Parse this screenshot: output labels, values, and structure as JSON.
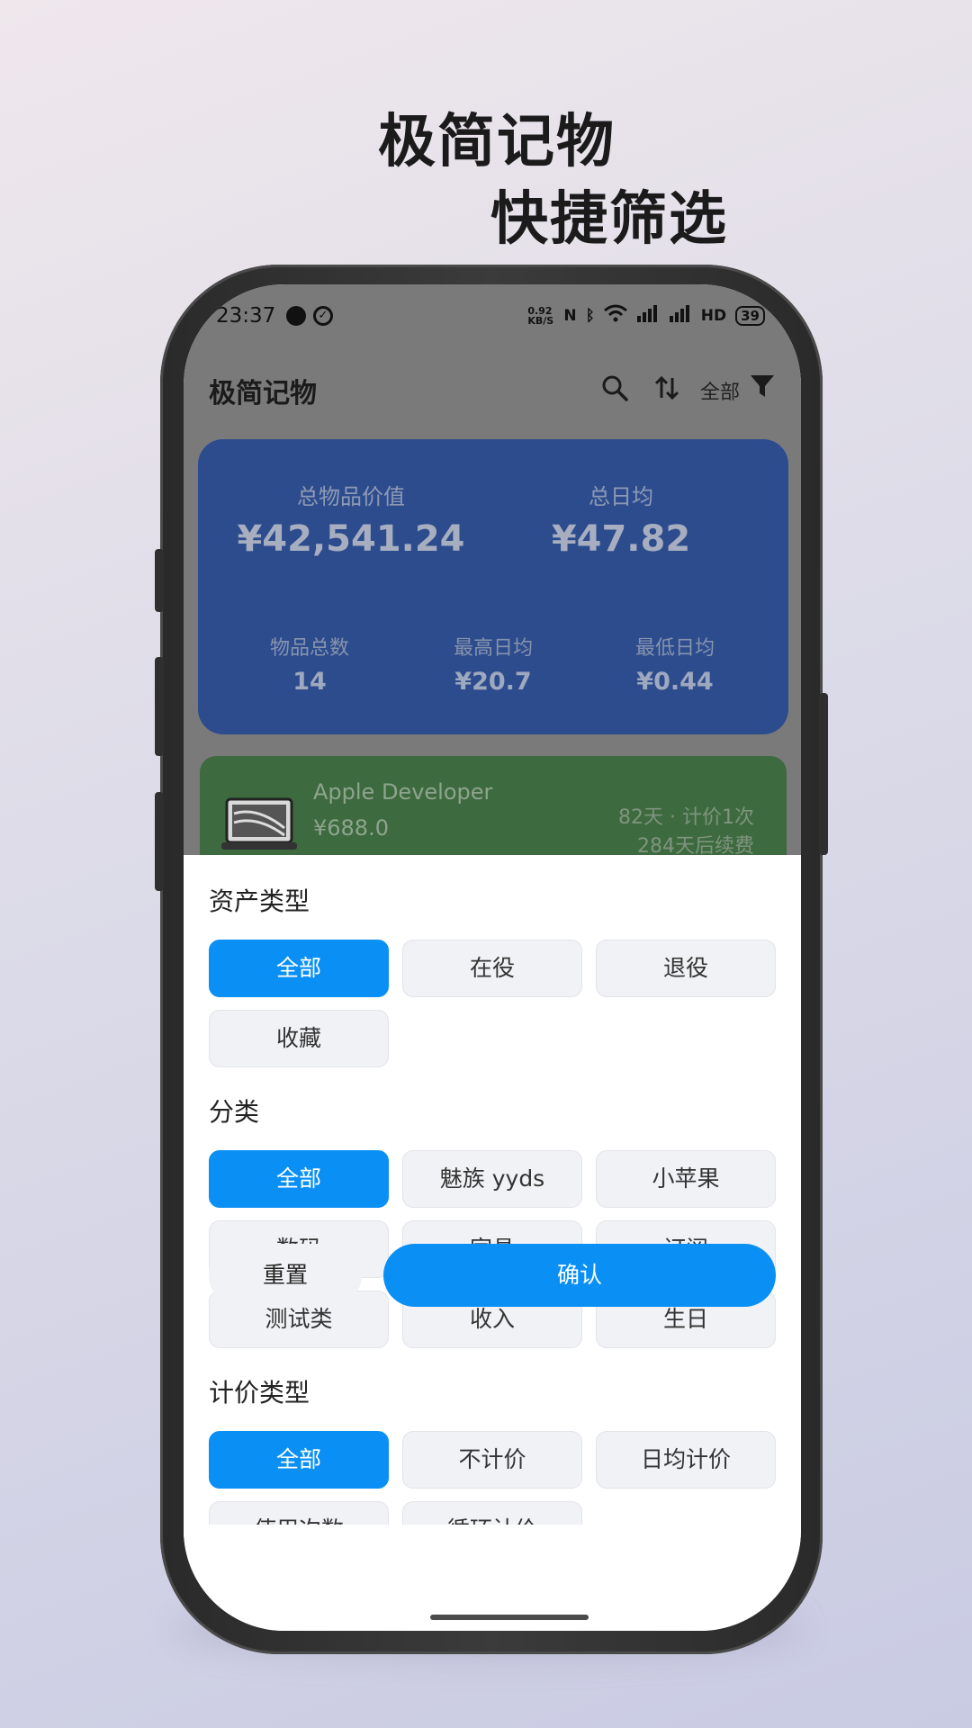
{
  "promo": {
    "title": "极简记物",
    "subtitle": "快捷筛选"
  },
  "status_bar": {
    "time": "23:37",
    "net_speed": "0.92 KB/S",
    "network": "HD",
    "battery": "39"
  },
  "app_bar": {
    "title": "极简记物",
    "filter_label": "全部"
  },
  "summary": {
    "total_value_label": "总物品价值",
    "total_value": "¥42,541.24",
    "daily_avg_label": "总日均",
    "daily_avg": "¥47.82",
    "count_label": "物品总数",
    "count": "14",
    "max_daily_label": "最高日均",
    "max_daily": "¥20.7",
    "min_daily_label": "最低日均",
    "min_daily": "¥0.44"
  },
  "item_card": {
    "name": "Apple Developer",
    "price": "¥688.0",
    "meta_days": "82天 · 计价1次",
    "meta_renew": "284天后续费"
  },
  "filter_sheet": {
    "asset_type": {
      "title": "资产类型",
      "options": [
        "全部",
        "在役",
        "退役",
        "收藏"
      ]
    },
    "category": {
      "title": "分类",
      "options": [
        "全部",
        "魅族 yyds",
        "小苹果",
        "数码",
        "家具",
        "订阅",
        "测试类",
        "收入",
        "生日"
      ]
    },
    "pricing_type": {
      "title": "计价类型",
      "options": [
        "全部",
        "不计价",
        "日均计价",
        "使用次数",
        "循环计价"
      ]
    },
    "reset_label": "重置",
    "confirm_label": "确认"
  },
  "colors": {
    "accent": "#0a8ff5",
    "summary_card": "#2d4c8e",
    "item_card": "#3e6a3f"
  }
}
